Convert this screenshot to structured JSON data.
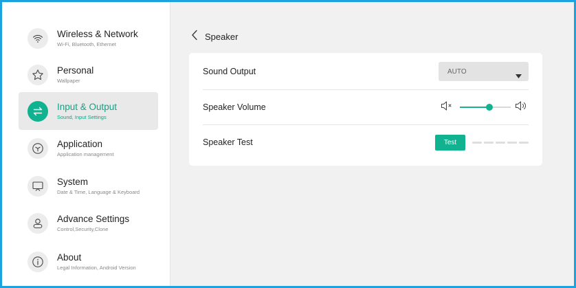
{
  "colors": {
    "accent": "#10b28f",
    "border": "#1aa3e0"
  },
  "sidebar": {
    "items": [
      {
        "title": "Wireless & Network",
        "subtitle": "Wi-Fi, Bluetooth, Ethernet",
        "icon": "wifi-icon",
        "active": false
      },
      {
        "title": "Personal",
        "subtitle": "Wallpaper",
        "icon": "star-icon",
        "active": false
      },
      {
        "title": "Input & Output",
        "subtitle": "Sound, Input Settings",
        "icon": "swap-arrows-icon",
        "active": true
      },
      {
        "title": "Application",
        "subtitle": "Application management",
        "icon": "cube-icon",
        "active": false
      },
      {
        "title": "System",
        "subtitle": "Date & Time, Language & Keyboard",
        "icon": "monitor-icon",
        "active": false
      },
      {
        "title": "Advance Settings",
        "subtitle": "Control,Security,Clone",
        "icon": "user-icon",
        "active": false
      },
      {
        "title": "About",
        "subtitle": "Legal Information, Android Version",
        "icon": "info-icon",
        "active": false
      }
    ]
  },
  "header": {
    "title": "Speaker",
    "back_icon": "chevron-left-icon"
  },
  "settings": {
    "sound_output": {
      "label": "Sound Output",
      "value": "AUTO"
    },
    "speaker_volume": {
      "label": "Speaker Volume",
      "level": 0.58
    },
    "speaker_test": {
      "label": "Speaker Test",
      "button": "Test",
      "level_segments": 5,
      "level_active": 0
    }
  }
}
